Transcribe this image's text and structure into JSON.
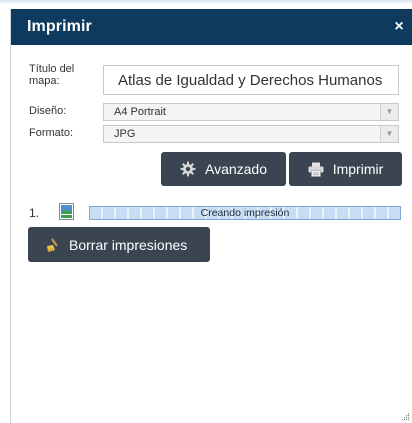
{
  "panel": {
    "title": "Imprimir",
    "close_glyph": "×"
  },
  "form": {
    "title_label": "Título del mapa:",
    "title_value": "Atlas de Igualdad y Derechos Humanos",
    "layout_label": "Diseño:",
    "layout_value": "A4 Portrait",
    "format_label": "Formato:",
    "format_value": "JPG"
  },
  "buttons": {
    "advanced_label": "Avanzado",
    "print_label": "Imprimir",
    "clear_label": "Borrar impresiones"
  },
  "jobs": [
    {
      "number": "1.",
      "status": "Creando impresión"
    }
  ],
  "icons": {
    "close": "close-icon",
    "advanced": "gear-icon",
    "print": "printer-icon",
    "clear": "broom-icon",
    "file": "image-file-icon",
    "dropdown": "chevron-down-icon"
  },
  "colors": {
    "header": "#0f3a5f",
    "button": "#3b4551",
    "progress_border": "#7fa7d4"
  }
}
